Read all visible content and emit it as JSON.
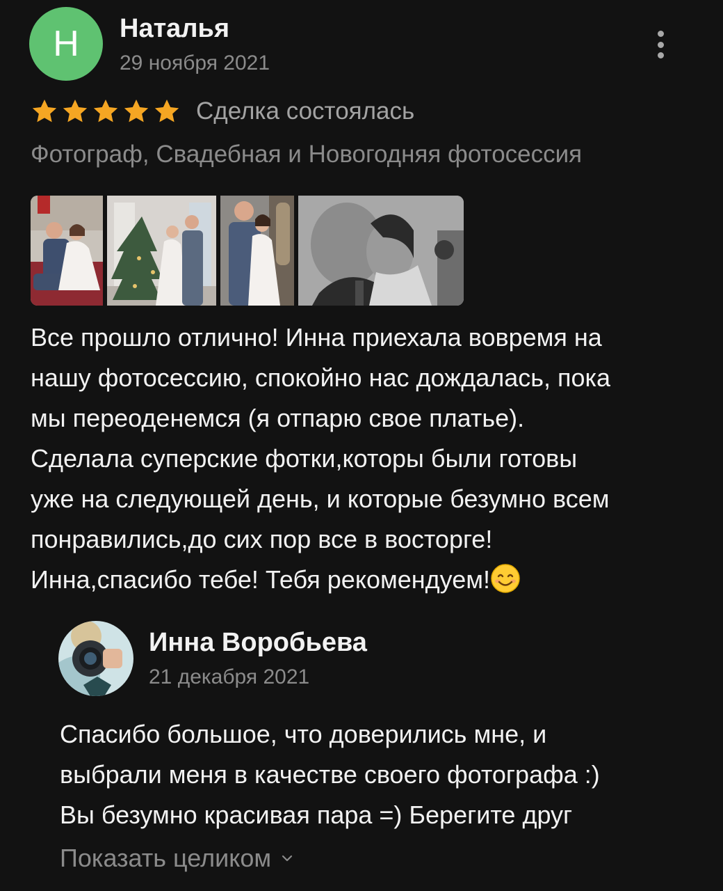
{
  "review": {
    "avatar_letter": "Н",
    "avatar_color": "#5fc271",
    "author": "Наталья",
    "date": "29 ноября 2021",
    "rating": 5,
    "star_color": "#f5a623",
    "deal_status": "Сделка состоялась",
    "service": "Фотограф, Свадебная и Новогодняя фотосессия",
    "photos": [
      {
        "icon": "wedding-photo-1"
      },
      {
        "icon": "wedding-photo-2"
      },
      {
        "icon": "wedding-photo-3"
      },
      {
        "icon": "wedding-photo-4"
      }
    ],
    "text_lines": [
      "Все прошло отлично! Инна приехала вовремя на",
      "нашу фотосессию, спокойно нас дождалась, пока",
      "мы переоденемся (я отпарю свое платье).",
      "Сделала суперские фотки,которы были готовы",
      "уже на следующей день, и которые безумно всем",
      "понравились,до сих пор все в восторге!",
      "Инна,спасибо тебе! Тебя рекомендуем!"
    ],
    "emoji": "smiling-face-icon"
  },
  "reply": {
    "author": "Инна Воробьева",
    "date": "21 декабря 2021",
    "text_lines": [
      "Спасибо большое, что доверились мне, и",
      "выбрали меня в качестве своего фотографа :)",
      "Вы безумно красивая пара =) Берегите друг"
    ],
    "show_more": "Показать целиком"
  }
}
